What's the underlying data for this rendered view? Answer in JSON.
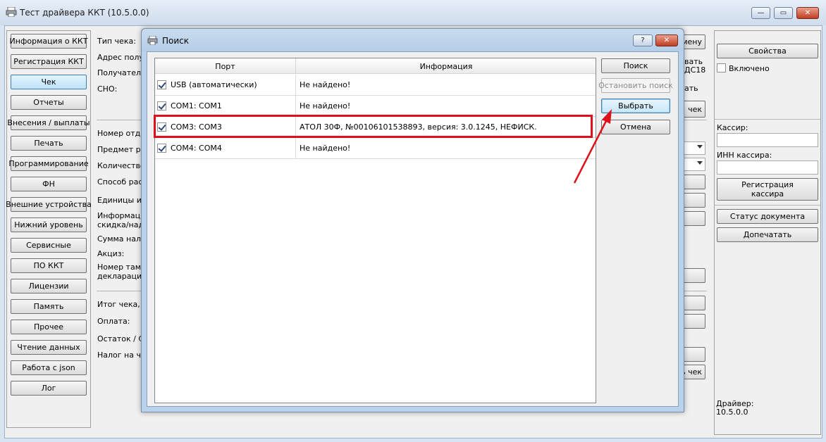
{
  "window": {
    "title": "Тест драйвера ККТ (10.5.0.0)",
    "controls": {
      "minimize": "—",
      "maximize": "▭",
      "close": "✕"
    }
  },
  "left_nav": {
    "items": [
      "Информация о ККТ",
      "Регистрация ККТ",
      "Чек",
      "Отчеты",
      "Внесения / выплаты",
      "Печать",
      "Программирование",
      "ФН",
      "Внешние устройства",
      "Нижний уровень",
      "Сервисные",
      "ПО ККТ",
      "Лицензии",
      "Память",
      "Прочее",
      "Чтение данных",
      "Работа с json",
      "Лог"
    ],
    "selected": "Чек"
  },
  "form": {
    "labels": [
      "Тип чека:",
      "Адрес получ",
      "Получатель",
      "СНО:",
      "Номер отде",
      "Предмет ра",
      "Количество",
      "Способ расч",
      "Единицы изм",
      "Информаци",
      "скидка/надб",
      "Сумма налог",
      "Акциз:",
      "Номер тамож",
      "декларации",
      "Итог чека, р",
      "Оплата:",
      "Остаток / С",
      "Налог на чек"
    ],
    "right_fragments": [
      "мену",
      "вать",
      "ДС18",
      "ать",
      "чек",
      "ь чек"
    ]
  },
  "right_panel": {
    "properties_button": "Свойства",
    "enabled_label": "Включено",
    "cashier_label": "Кассир:",
    "cashier_inn_label": "ИНН кассира:",
    "register_cashier_button": [
      "Регистрация",
      "кассира"
    ],
    "doc_status_button": "Статус документа",
    "reprint_button": "Допечатать",
    "driver_label": "Драйвер:",
    "driver_version": "10.5.0.0"
  },
  "dialog": {
    "title": "Поиск",
    "help": "?",
    "close": "✕",
    "columns": {
      "port": "Порт",
      "info": "Информация"
    },
    "rows": [
      {
        "port": "USB (автоматически)",
        "info": "Не найдено!",
        "checked": true
      },
      {
        "port": "COM1: COM1",
        "info": "Не найдено!",
        "checked": true
      },
      {
        "port": "COM3: COM3",
        "info": "АТОЛ 30Ф, №00106101538893, версия: 3.0.1245, НЕФИСК.",
        "checked": true
      },
      {
        "port": "COM4: COM4",
        "info": "Не найдено!",
        "checked": true
      }
    ],
    "buttons": {
      "search": "Поиск",
      "stop": "Остановить поиск",
      "select": "Выбрать",
      "cancel": "Отмена"
    }
  },
  "colors": {
    "highlight": "#e0101a",
    "accent": "#3c7fb1"
  }
}
